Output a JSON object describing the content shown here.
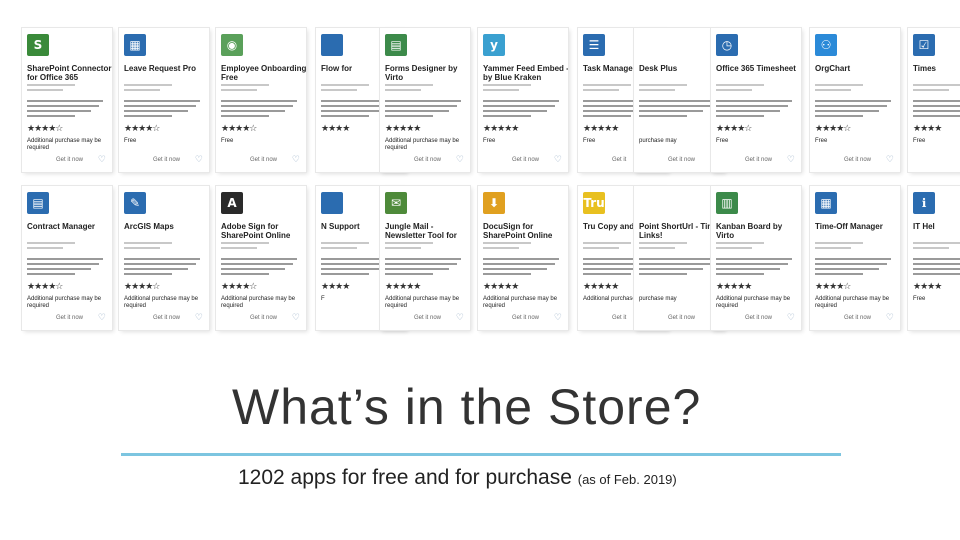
{
  "slide": {
    "title": "What’s in the Store?",
    "subtitle_main": "1202 apps for free and for purchase",
    "subtitle_note": "(as of Feb. 2019)",
    "accent_color": "#7cc5e0"
  },
  "cards_row1": [
    {
      "title": "SharePoint Connector for Office 365",
      "stars": "★★★★☆",
      "price": "Additional purchase may be required",
      "get": "Get it now",
      "logo": "S",
      "color": "#3a8a3a"
    },
    {
      "title": "Leave Request Pro",
      "stars": "★★★★☆",
      "price": "Free",
      "get": "Get it now",
      "logo": "▦",
      "color": "#2b6cb0"
    },
    {
      "title": "Employee Onboarding Free",
      "stars": "★★★★☆",
      "price": "Free",
      "get": "Get it now",
      "logo": "◉",
      "color": "#5aa05a"
    },
    {
      "title": "Flow for",
      "stars": "★★★★",
      "price": "",
      "get": "",
      "logo": "",
      "color": "#2b6cb0"
    },
    {
      "title": "Forms Designer by Virto",
      "stars": "★★★★★",
      "price": "Additional purchase may be required",
      "get": "Get it now",
      "logo": "▤",
      "color": "#3c8a4a"
    },
    {
      "title": "Yammer Feed Embed - by Blue Kraken",
      "stars": "★★★★★",
      "price": "Free",
      "get": "Get it now",
      "logo": "y",
      "color": "#3aa0d0"
    },
    {
      "title": "Task Managem",
      "stars": "★★★★★",
      "price": "Free",
      "get": "Get it",
      "logo": "☰",
      "color": "#2b6cb0"
    },
    {
      "title": "Desk Plus",
      "stars": "",
      "price": "purchase may",
      "get": "Get it now",
      "logo": "",
      "color": "#ffffff"
    },
    {
      "title": "Office 365 Timesheet",
      "stars": "★★★★☆",
      "price": "Free",
      "get": "Get it now",
      "logo": "◷",
      "color": "#2b6cb0"
    },
    {
      "title": "OrgChart",
      "stars": "★★★★☆",
      "price": "Free",
      "get": "Get it now",
      "logo": "⚇",
      "color": "#2b8ad8"
    },
    {
      "title": "Times",
      "stars": "★★★★",
      "price": "Free",
      "get": "",
      "logo": "☑",
      "color": "#2b6cb0"
    }
  ],
  "cards_row2": [
    {
      "title": "Contract Manager",
      "stars": "★★★★☆",
      "price": "Additional purchase may be required",
      "get": "Get it now",
      "logo": "▤",
      "color": "#2b6cb0"
    },
    {
      "title": "ArcGIS Maps",
      "stars": "★★★★☆",
      "price": "Additional purchase may be required",
      "get": "Get it now",
      "logo": "✎",
      "color": "#2b6cb0"
    },
    {
      "title": "Adobe Sign for SharePoint Online",
      "stars": "★★★★☆",
      "price": "Additional purchase may be required",
      "get": "Get it now",
      "logo": "A",
      "color": "#2a2a2a"
    },
    {
      "title": "N Support",
      "stars": "★★★★",
      "price": "F",
      "get": "",
      "logo": "",
      "color": "#2b6cb0"
    },
    {
      "title": "Jungle Mail - Newsletter Tool for Office 365",
      "stars": "★★★★★",
      "price": "Additional purchase may be required",
      "get": "Get it now",
      "logo": "✉",
      "color": "#4e8a3a"
    },
    {
      "title": "DocuSign for SharePoint Online",
      "stars": "★★★★★",
      "price": "Additional purchase may be required",
      "get": "Get it now",
      "logo": "⬇",
      "color": "#e0a020"
    },
    {
      "title": "Tru Copy and",
      "stars": "★★★★★",
      "price": "Additional purchase may",
      "get": "Get it",
      "logo": "Tru",
      "color": "#e8c020"
    },
    {
      "title": "Point ShortUrl - Tiny Links!",
      "stars": "",
      "price": "purchase may",
      "get": "Get it now",
      "logo": "",
      "color": "#ffffff"
    },
    {
      "title": "Kanban Board by Virto",
      "stars": "★★★★★",
      "price": "Additional purchase may be required",
      "get": "Get it now",
      "logo": "▥",
      "color": "#3c8a4a"
    },
    {
      "title": "Time-Off Manager",
      "stars": "★★★★☆",
      "price": "Additional purchase may be required",
      "get": "Get it now",
      "logo": "▦",
      "color": "#2b6cb0"
    },
    {
      "title": "IT Hel",
      "stars": "★★★★",
      "price": "Free",
      "get": "",
      "logo": "ℹ",
      "color": "#2b6cb0"
    }
  ]
}
